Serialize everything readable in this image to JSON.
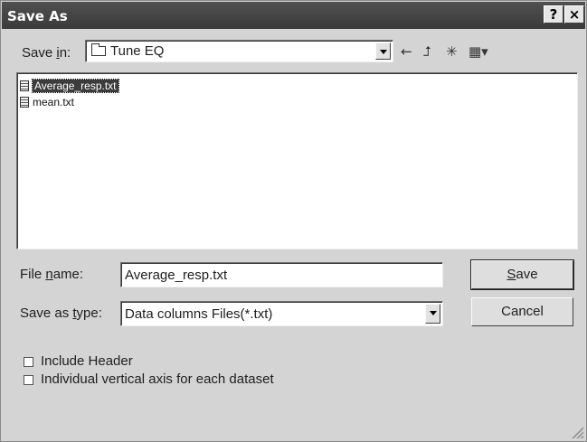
{
  "window": {
    "title": "Save As",
    "help_glyph": "?",
    "close_glyph": "×"
  },
  "save_in": {
    "label_pre": "Save ",
    "label_key": "i",
    "label_post": "n:",
    "value": "Tune EQ",
    "folder_icon": "folder-icon"
  },
  "toolbar": {
    "back_icon": "back-arrow-icon",
    "up_icon": "up-folder-icon",
    "new_folder_icon": "new-folder-icon",
    "view_icon": "view-menu-icon",
    "back_glyph": "←",
    "up_glyph": "⮥",
    "new_folder_glyph": "✳",
    "view_glyph": "▦▾"
  },
  "files": [
    {
      "name": "Average_resp.txt",
      "selected": true
    },
    {
      "name": "mean.txt",
      "selected": false
    }
  ],
  "file_name": {
    "label_pre": "File ",
    "label_key": "n",
    "label_post": "ame:",
    "value": "Average_resp.txt"
  },
  "save_as_type": {
    "label_pre": "Save as ",
    "label_key": "t",
    "label_post": "ype:",
    "value": "Data columns Files(*.txt)"
  },
  "buttons": {
    "save_key": "S",
    "save_rest": "ave",
    "cancel": "Cancel"
  },
  "options": [
    {
      "label": "Include Header",
      "checked": false
    },
    {
      "label": "Individual vertical axis for each dataset",
      "checked": false
    }
  ]
}
